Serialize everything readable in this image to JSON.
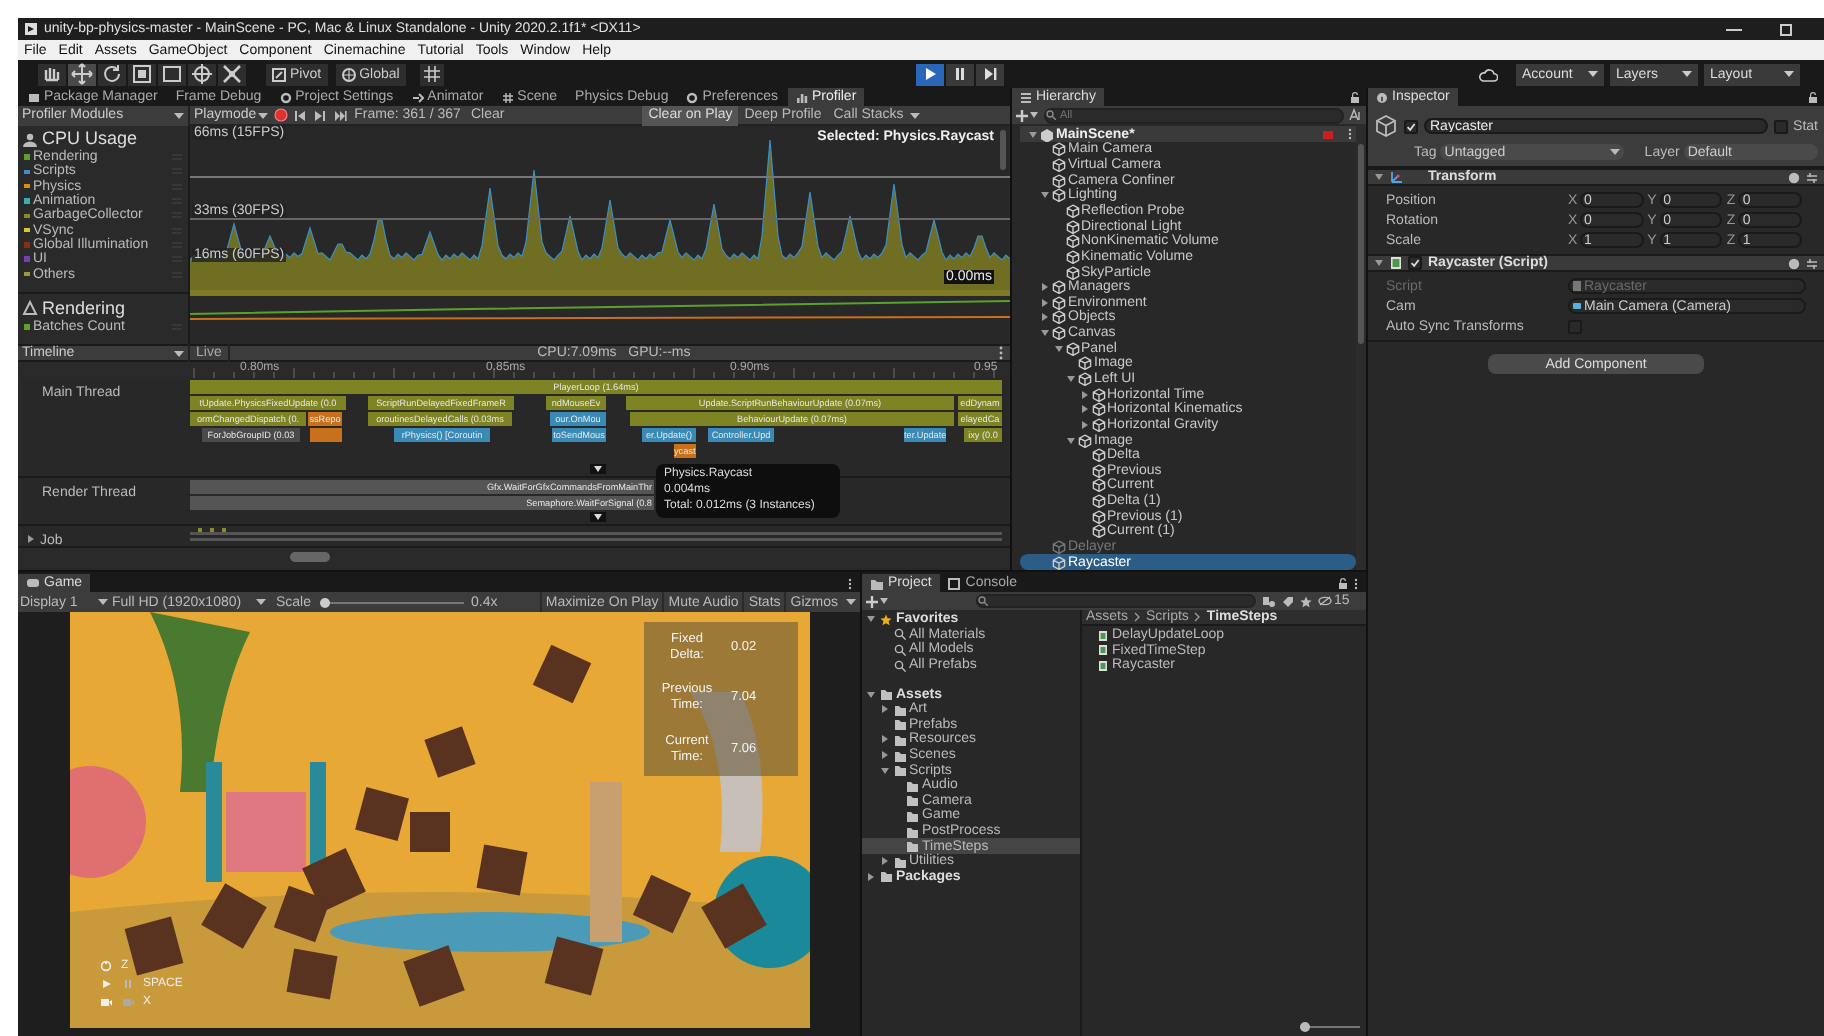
{
  "window": {
    "title": "unity-bp-physics-master - MainScene - PC, Mac & Linux Standalone - Unity 2020.2.1f1* <DX11>"
  },
  "menu": [
    "File",
    "Edit",
    "Assets",
    "GameObject",
    "Component",
    "Cinemachine",
    "Tutorial",
    "Tools",
    "Window",
    "Help"
  ],
  "toolbar": {
    "tools": [
      {
        "kind": "hand",
        "selected": false
      },
      {
        "kind": "move",
        "selected": true
      },
      {
        "kind": "rotate",
        "selected": false
      },
      {
        "kind": "scale",
        "selected": false
      },
      {
        "kind": "rect",
        "selected": false
      },
      {
        "kind": "transform",
        "selected": false
      },
      {
        "kind": "custom",
        "selected": false
      }
    ],
    "pivot": "Pivot",
    "global": "Global",
    "playback": [
      {
        "kind": "play",
        "selected": true
      },
      {
        "kind": "pause",
        "selected": false
      },
      {
        "kind": "step",
        "selected": false
      }
    ],
    "account": "Account",
    "layers": "Layers",
    "layout": "Layout"
  },
  "dock_tabs": [
    {
      "label": "Package Manager",
      "selected": false
    },
    {
      "label": "Frame Debug",
      "selected": false
    },
    {
      "label": "Project Settings",
      "selected": false
    },
    {
      "label": "Animator",
      "selected": false
    },
    {
      "label": "Scene",
      "selected": false
    },
    {
      "label": "Physics Debug",
      "selected": false
    },
    {
      "label": "Preferences",
      "selected": false
    },
    {
      "label": "Profiler",
      "selected": true
    }
  ],
  "profiler": {
    "modules_label": "Profiler Modules",
    "mode": "Playmode",
    "recording": true,
    "frame": "Frame: 361 / 367",
    "clear": "Clear",
    "options": [
      {
        "label": "Clear on Play",
        "selected": true
      },
      {
        "label": "Deep Profile",
        "selected": false
      },
      {
        "label": "Call Stacks",
        "selected": false
      }
    ],
    "selected_label": "Selected: Physics.Raycast",
    "cpu": {
      "title": "CPU Usage",
      "series": [
        {
          "name": "Rendering",
          "color": "#5aa02c"
        },
        {
          "name": "Scripts",
          "color": "#3c8fc7"
        },
        {
          "name": "Physics",
          "color": "#e08a1c"
        },
        {
          "name": "Animation",
          "color": "#38b0b0"
        },
        {
          "name": "GarbageCollector",
          "color": "#8a8a2a"
        },
        {
          "name": "VSync",
          "color": "#d8c82c"
        },
        {
          "name": "Global Illumination",
          "color": "#8c2c14"
        },
        {
          "name": "UI",
          "color": "#7040b8"
        },
        {
          "name": "Others",
          "color": "#9a9a3c"
        }
      ],
      "graph_labels": [
        "66ms (15FPS)",
        "33ms (30FPS)",
        "16ms (60FPS)"
      ],
      "graph_value": "0.00ms"
    },
    "rendering": {
      "title": "Rendering",
      "series": [
        {
          "name": "Batches Count",
          "color": "#5aa02c"
        }
      ]
    },
    "timeline": {
      "view": "Timeline",
      "mode": "Live",
      "stats": "CPU:7.09ms   GPU:--ms",
      "ticks": [
        "0.80ms",
        "0.85ms",
        "0.90ms",
        "0.95"
      ],
      "threads": [
        {
          "name": "Main Thread",
          "expanded": true,
          "rows": [
            {
              "bars": [
                {
                  "label": "PlayerLoop (1.64ms)",
                  "color": "#7e8424"
                }
              ]
            },
            {
              "bars": [
                {
                  "label": "tUpdate.PhysicsFixedUpdate (0.0",
                  "color": "#7e8424"
                },
                {
                  "label": "ScriptRunDelayedFixedFrameR",
                  "color": "#7e8424"
                },
                {
                  "label": "ndMouseEv",
                  "color": "#7e8424"
                },
                {
                  "label": "Update.ScriptRunBehaviourUpdate (0.07ms)",
                  "color": "#7e8424"
                },
                {
                  "label": "edDynam",
                  "color": "#7e8424"
                }
              ]
            },
            {
              "bars": [
                {
                  "label": "ormChangedDispatch (0.",
                  "color": "#7e8424"
                },
                {
                  "label": "ssRepo",
                  "color": "#c8701a"
                },
                {
                  "label": "oroutinesDelayedCalls (0.03ms",
                  "color": "#7e8424"
                },
                {
                  "label": "our.OnMou",
                  "color": "#3a8ab8"
                },
                {
                  "label": "BehaviourUpdate (0.07ms)",
                  "color": "#7e8424"
                },
                {
                  "label": "elayedCa",
                  "color": "#7e8424"
                }
              ]
            },
            {
              "bars": [
                {
                  "label": "ForJobGroupID (0.03",
                  "color": "#4a4a4a"
                },
                {
                  "color": "#c8701a"
                },
                {
                  "label": "rPhysics() [Coroutin",
                  "color": "#3a8ab8"
                },
                {
                  "label": "toSendMous",
                  "color": "#3a8ab8"
                },
                {
                  "label": "er.Update()",
                  "color": "#3a8ab8"
                },
                {
                  "label": "Controller.Upd",
                  "color": "#3a8ab8"
                },
                {
                  "label": "ter.Update",
                  "color": "#3a8ab8"
                },
                {
                  "label": "ixy (0.0",
                  "color": "#7e8424"
                }
              ]
            },
            {
              "bars": [
                {
                  "label": "ycast",
                  "color": "#c8701a"
                }
              ]
            }
          ]
        },
        {
          "name": "Render Thread",
          "expanded": true,
          "rows": [
            {
              "bars": [
                {
                  "label": "Gfx.WaitForGfxCommandsFromMainThr",
                  "color": "#555555"
                }
              ]
            },
            {
              "bars": [
                {
                  "label": "Semaphore.WaitForSignal (0.8",
                  "color": "#555555"
                }
              ]
            }
          ]
        },
        {
          "name": "Job",
          "expanded": false
        }
      ],
      "tooltip": [
        "Physics.Raycast",
        "0.004ms",
        "Total: 0.012ms (3 Instances)"
      ]
    }
  },
  "hierarchy": {
    "title": "Hierarchy",
    "search_placeholder": "All",
    "scene": {
      "label": "MainScene*",
      "expanded": true
    },
    "items": [
      {
        "label": "Main Camera",
        "selected": false,
        "disabled": false
      },
      {
        "label": "Virtual Camera",
        "selected": false,
        "disabled": false
      },
      {
        "label": "Camera Confiner",
        "selected": false,
        "disabled": false
      },
      {
        "label": "Lighting",
        "selected": false,
        "disabled": false,
        "expanded": true,
        "children": [
          {
            "label": "Reflection Probe",
            "selected": false,
            "disabled": false
          },
          {
            "label": "Directional Light",
            "selected": false,
            "disabled": false
          },
          {
            "label": "NonKinematic Volume",
            "selected": false,
            "disabled": false
          },
          {
            "label": "Kinematic Volume",
            "selected": false,
            "disabled": false
          },
          {
            "label": "SkyParticle",
            "selected": false,
            "disabled": false
          }
        ]
      },
      {
        "label": "Managers",
        "selected": false,
        "disabled": false,
        "expanded": false
      },
      {
        "label": "Environment",
        "selected": false,
        "disabled": false,
        "expanded": false
      },
      {
        "label": "Objects",
        "selected": false,
        "disabled": false,
        "expanded": false
      },
      {
        "label": "Canvas",
        "selected": false,
        "disabled": false,
        "expanded": true,
        "children": [
          {
            "label": "Panel",
            "selected": false,
            "disabled": false,
            "expanded": true,
            "children": [
              {
                "label": "Image",
                "selected": false,
                "disabled": false
              },
              {
                "label": "Left UI",
                "selected": false,
                "disabled": false,
                "expanded": true,
                "children": [
                  {
                    "label": "Horizontal Time",
                    "selected": false,
                    "disabled": false,
                    "expanded": false
                  },
                  {
                    "label": "Horizontal Kinematics",
                    "selected": false,
                    "disabled": false,
                    "expanded": false
                  },
                  {
                    "label": "Horizontal Gravity",
                    "selected": false,
                    "disabled": false,
                    "expanded": false
                  }
                ]
              },
              {
                "label": "Image",
                "selected": false,
                "disabled": false,
                "expanded": true,
                "children": [
                  {
                    "label": "Delta",
                    "selected": false,
                    "disabled": false
                  },
                  {
                    "label": "Previous",
                    "selected": false,
                    "disabled": false
                  },
                  {
                    "label": "Current",
                    "selected": false,
                    "disabled": false
                  },
                  {
                    "label": "Delta (1)",
                    "selected": false,
                    "disabled": false
                  },
                  {
                    "label": "Previous (1)",
                    "selected": false,
                    "disabled": false
                  },
                  {
                    "label": "Current (1)",
                    "selected": false,
                    "disabled": false
                  }
                ]
              }
            ]
          }
        ]
      },
      {
        "label": "Delayer",
        "selected": false,
        "disabled": true
      },
      {
        "label": "Raycaster",
        "selected": true,
        "disabled": false
      }
    ]
  },
  "inspector": {
    "title": "Inspector",
    "active": true,
    "name": "Raycaster",
    "static": {
      "label": "Stat",
      "checked": false
    },
    "tag_label": "Tag",
    "tag": "Untagged",
    "layer_label": "Layer",
    "layer": "Default",
    "components": [
      {
        "kind": "transform",
        "title": "Transform",
        "fields": [
          {
            "label": "Position",
            "values": [
              {
                "axis": "X",
                "value": "0"
              },
              {
                "axis": "Y",
                "value": "0"
              },
              {
                "axis": "Z",
                "value": "0"
              }
            ]
          },
          {
            "label": "Rotation",
            "values": [
              {
                "axis": "X",
                "value": "0"
              },
              {
                "axis": "Y",
                "value": "0"
              },
              {
                "axis": "Z",
                "value": "0"
              }
            ]
          },
          {
            "label": "Scale",
            "values": [
              {
                "axis": "X",
                "value": "1"
              },
              {
                "axis": "Y",
                "value": "1"
              },
              {
                "axis": "Z",
                "value": "1"
              }
            ]
          }
        ]
      },
      {
        "kind": "script",
        "title": "Raycaster (Script)",
        "enabled": true,
        "fields": [
          {
            "kind": "object",
            "label": "Script",
            "value": "Raycaster",
            "disabled": true
          },
          {
            "kind": "object",
            "label": "Cam",
            "value": "Main Camera (Camera)",
            "disabled": false
          },
          {
            "kind": "checkbox",
            "label": "Auto Sync Transforms",
            "checked": false,
            "disabled": false
          }
        ]
      }
    ],
    "add_button": "Add Component"
  },
  "game": {
    "title": "Game",
    "display": "Display 1",
    "resolution": "Full HD (1920x1080)",
    "scale_label": "Scale",
    "scale": {
      "level": 0
    },
    "scale_value": "0.4x",
    "buttons": [
      {
        "label": "Maximize On Play",
        "selected": false
      },
      {
        "label": "Mute Audio",
        "selected": false
      },
      {
        "label": "Stats",
        "selected": false
      },
      {
        "label": "Gizmos",
        "selected": false
      }
    ],
    "overlay": [
      {
        "label": "Fixed Delta:",
        "value": "0.02"
      },
      {
        "label": "Previous Time:",
        "value": "7.04"
      },
      {
        "label": "Current Time:",
        "value": "7.06"
      }
    ],
    "controls": [
      {
        "kind": "reset",
        "key": "Z"
      },
      {
        "kind": "play",
        "key": "SPACE"
      },
      {
        "kind": "camera",
        "key": "X"
      }
    ]
  },
  "project": {
    "tabs": [
      {
        "label": "Project",
        "selected": true
      },
      {
        "label": "Console",
        "selected": false
      }
    ],
    "hidden_count": "15",
    "tree": [
      {
        "label": "Favorites",
        "kind": "favorites",
        "expanded": true,
        "selected": false,
        "children": [
          {
            "label": "All Materials",
            "kind": "search",
            "selected": false
          },
          {
            "label": "All Models",
            "kind": "search",
            "selected": false
          },
          {
            "label": "All Prefabs",
            "kind": "search",
            "selected": false
          }
        ]
      },
      {
        "label": "Assets",
        "kind": "folder",
        "expanded": true,
        "selected": false,
        "children": [
          {
            "label": "Art",
            "kind": "folder",
            "expanded": false,
            "selected": false
          },
          {
            "label": "Prefabs",
            "kind": "folder",
            "selected": false
          },
          {
            "label": "Resources",
            "kind": "folder",
            "expanded": false,
            "selected": false
          },
          {
            "label": "Scenes",
            "kind": "folder",
            "expanded": false,
            "selected": false
          },
          {
            "label": "Scripts",
            "kind": "folder",
            "expanded": true,
            "selected": false,
            "children": [
              {
                "label": "Audio",
                "kind": "folder",
                "selected": false
              },
              {
                "label": "Camera",
                "kind": "folder",
                "selected": false
              },
              {
                "label": "Game",
                "kind": "folder",
                "selected": false
              },
              {
                "label": "PostProcess",
                "kind": "folder",
                "selected": false
              },
              {
                "label": "TimeSteps",
                "kind": "folder",
                "selected": true
              }
            ]
          },
          {
            "label": "Utilities",
            "kind": "folder",
            "expanded": false,
            "selected": false
          }
        ]
      },
      {
        "label": "Packages",
        "kind": "folder",
        "expanded": false,
        "selected": false
      }
    ],
    "breadcrumb": [
      "Assets",
      "Scripts",
      "TimeSteps"
    ],
    "files": [
      "DelayUpdateLoop",
      "FixedTimeStep",
      "Raycaster"
    ],
    "icon_size": {
      "level": 0
    }
  }
}
